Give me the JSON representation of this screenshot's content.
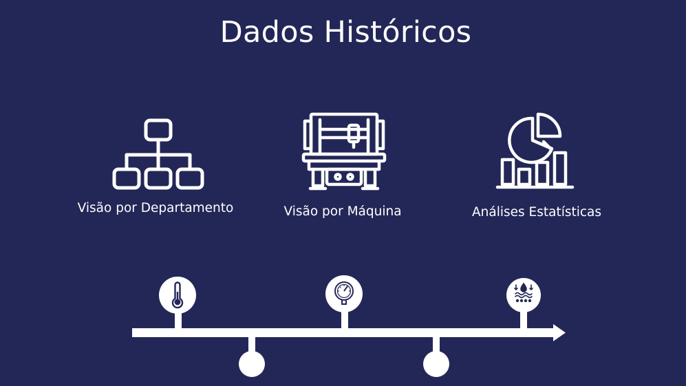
{
  "page": {
    "title": "Dados Históricos"
  },
  "nav_cards": [
    {
      "id": "departamento",
      "label": "Visão por Departamento",
      "icon": "org-chart-icon"
    },
    {
      "id": "maquina",
      "label": "Visão por Máquina",
      "icon": "cnc-machine-icon"
    },
    {
      "id": "estatisticas",
      "label": "Análises Estatísticas",
      "icon": "statistics-chart-icon"
    }
  ],
  "timeline": {
    "markers": [
      {
        "icon": "thermometer-icon"
      },
      {
        "icon": "pressure-gauge-icon"
      },
      {
        "icon": "water-level-icon"
      }
    ]
  },
  "colors": {
    "background": "#232757",
    "foreground": "#ffffff"
  }
}
